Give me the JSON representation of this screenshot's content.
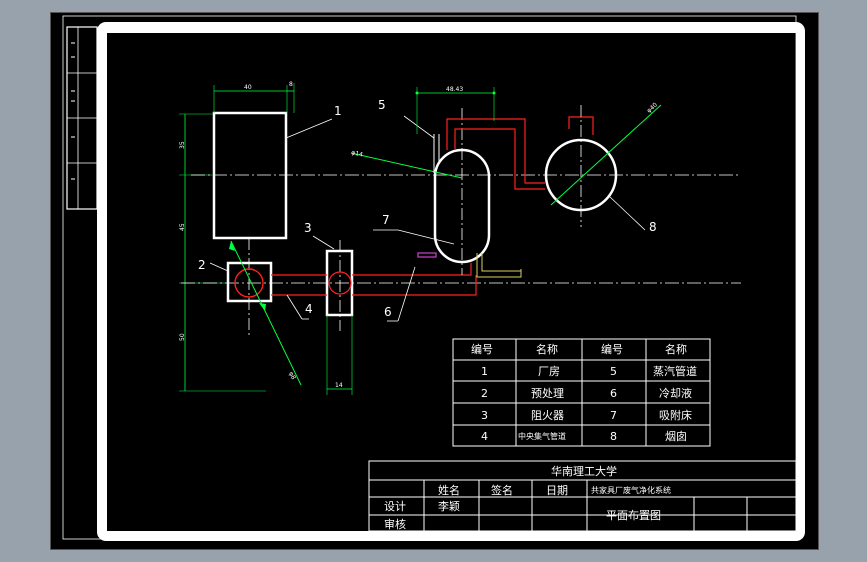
{
  "drawing": {
    "part_labels": [
      "1",
      "2",
      "3",
      "4",
      "5",
      "6",
      "7",
      "8"
    ],
    "dimensions": {
      "d40": "40",
      "d8": "8",
      "d4843": "48.43",
      "d40_diam": "φ40",
      "d14_diam": "φ14",
      "d35": "35",
      "d45": "45",
      "d50": "50",
      "d14": "14",
      "d8_diam": "φ8"
    }
  },
  "parts_table": {
    "headers": [
      "编号",
      "名称",
      "编号",
      "名称"
    ],
    "rows": [
      [
        "1",
        "厂房",
        "5",
        "蒸汽管道"
      ],
      [
        "2",
        "预处理",
        "6",
        "冷却液"
      ],
      [
        "3",
        "阻火器",
        "7",
        "吸附床"
      ],
      [
        "4",
        "中央集气管道",
        "8",
        "烟囱"
      ]
    ]
  },
  "title_block": {
    "school": "华南理工大学",
    "col_name": "姓名",
    "col_sign": "签名",
    "col_date": "日期",
    "project": "共家具厂废气净化系统",
    "row_design": "设计",
    "designer": "李颖",
    "row_review": "审核",
    "drawing_name": "平面布置图"
  },
  "colors": {
    "line": "#ffffff",
    "pipe_red": "#ff2020",
    "dim_green": "#00ff40",
    "cooling_yellow": "#d8d060",
    "leader_magenta": "#d040d0"
  }
}
